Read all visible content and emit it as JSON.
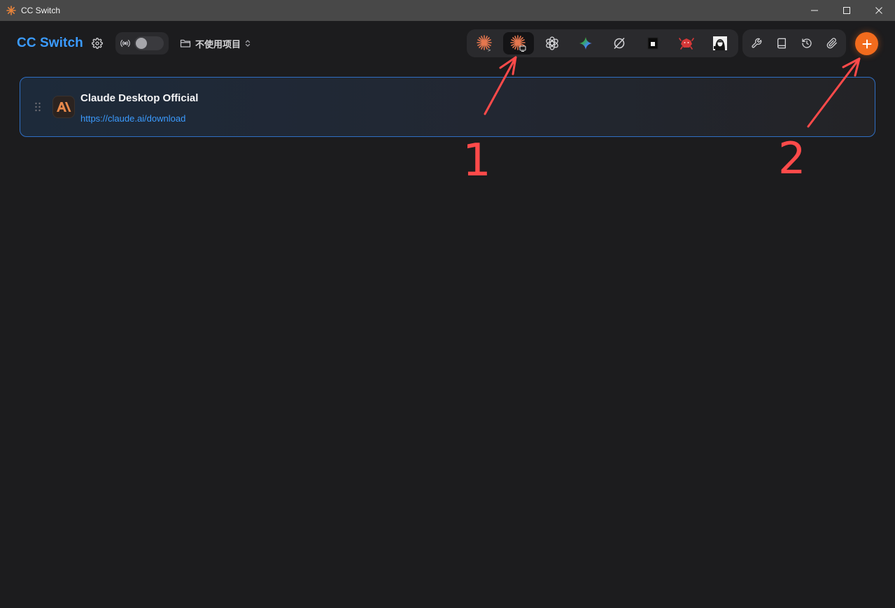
{
  "window": {
    "title": "CC Switch",
    "controls": [
      "minimize",
      "maximize",
      "close"
    ]
  },
  "header": {
    "brand": "CC Switch",
    "settings_icon": "gear-icon",
    "proxy_toggle": {
      "icon": "broadcast-icon",
      "enabled": false
    },
    "project_selector": {
      "label": "不使用项目",
      "icon": "folder-icon"
    }
  },
  "app_switcher": {
    "active_index": 1,
    "apps": [
      {
        "name": "claude-code",
        "icon": "claude-code-icon"
      },
      {
        "name": "claude-desktop",
        "icon": "claude-desktop-icon"
      },
      {
        "name": "codex",
        "icon": "openai-icon"
      },
      {
        "name": "gemini",
        "icon": "gemini-icon"
      },
      {
        "name": "opencode",
        "icon": "circle-slash-icon"
      },
      {
        "name": "terminal",
        "icon": "square-icon"
      },
      {
        "name": "crab",
        "icon": "crab-icon"
      },
      {
        "name": "avatar-app",
        "icon": "portrait-icon"
      }
    ]
  },
  "tools": [
    "wrench-icon",
    "book-icon",
    "history-icon",
    "paperclip-icon"
  ],
  "add_button": {
    "icon": "plus-icon"
  },
  "providers": [
    {
      "name": "Claude Desktop Official",
      "url": "https://claude.ai/download",
      "icon": "anthropic-icon",
      "active": true
    }
  ],
  "annotations": [
    "1",
    "2"
  ],
  "colors": {
    "accent_blue": "#3b9bff",
    "accent_orange": "#f26b1d",
    "annotation_red": "#ff4a4a",
    "background": "#1c1c1e"
  }
}
